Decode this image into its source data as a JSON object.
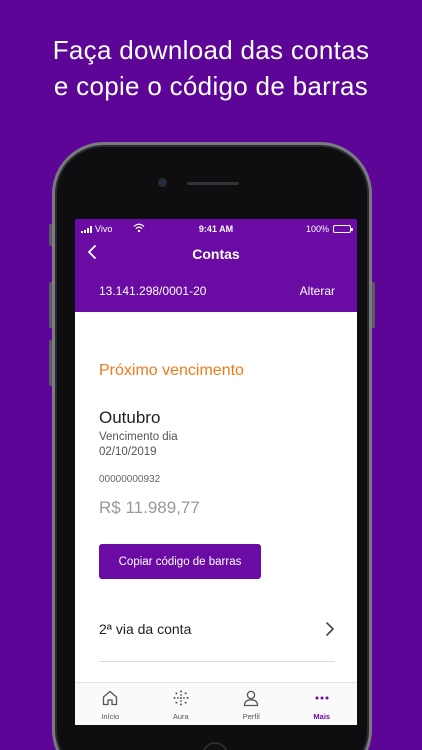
{
  "headline": {
    "line1": "Faça download das contas",
    "line2": "e copie o código de barras"
  },
  "status_bar": {
    "carrier": "Vivo",
    "time": "9:41 AM",
    "battery": "100%"
  },
  "header": {
    "title": "Contas",
    "back_icon": "chevron-left-icon",
    "cnpj": "13.141.298/0001-20",
    "change_label": "Alterar"
  },
  "bill": {
    "section_title": "Próximo vencimento",
    "month": "Outubro",
    "due_label": "Vencimento dia",
    "due_date": "02/10/2019",
    "document_number": "00000000932",
    "amount": "R$ 11.989,77",
    "copy_button_label": "Copiar código de barras"
  },
  "second_copy": {
    "label": "2ª via da conta",
    "icon": "chevron-right-icon"
  },
  "tabs": [
    {
      "label": "Início",
      "icon": "home-icon"
    },
    {
      "label": "Aura",
      "icon": "aura-dots-icon"
    },
    {
      "label": "Perfil",
      "icon": "user-icon"
    },
    {
      "label": "Mais",
      "icon": "more-dots-icon"
    }
  ],
  "colors": {
    "brand_purple": "#6a0ba3",
    "background_purple": "#5c0596",
    "accent_orange": "#f07a1a"
  }
}
